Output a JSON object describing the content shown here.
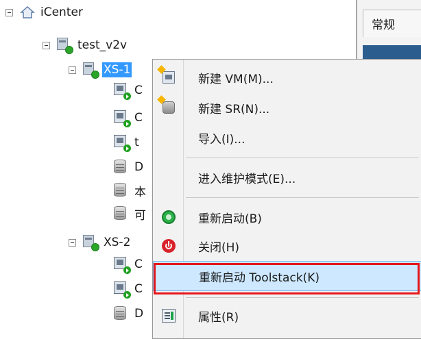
{
  "tree": {
    "root": {
      "label": "iCenter"
    },
    "pool": {
      "label": "test_v2v"
    },
    "host1": {
      "label": "XS-1"
    },
    "host1_children": [
      {
        "label": "C",
        "type": "vm"
      },
      {
        "label": "C",
        "type": "vm"
      },
      {
        "label": "t",
        "type": "vm"
      },
      {
        "label": "D",
        "type": "sr"
      },
      {
        "label": "本",
        "type": "sr"
      },
      {
        "label": "可",
        "type": "sr"
      }
    ],
    "host2": {
      "label": "XS-2"
    },
    "host2_children": [
      {
        "label": "C",
        "type": "vm"
      },
      {
        "label": "C",
        "type": "vm"
      },
      {
        "label": "D",
        "type": "sr"
      }
    ]
  },
  "right_panel": {
    "tab_label": "常规"
  },
  "context_menu": {
    "items": [
      {
        "label": "新建 VM(M)...",
        "icon": "new-vm-icon"
      },
      {
        "label": "新建 SR(N)...",
        "icon": "new-sr-icon"
      },
      {
        "label": "导入(I)...",
        "icon": ""
      },
      {
        "label": "进入维护模式(E)...",
        "icon": ""
      },
      {
        "label": "重新启动(B)",
        "icon": "restart-icon"
      },
      {
        "label": "关闭(H)",
        "icon": "power-icon"
      },
      {
        "label": "重新启动 Toolstack(K)",
        "icon": "",
        "highlighted": true
      },
      {
        "label": "属性(R)",
        "icon": "properties-icon"
      }
    ]
  },
  "colors": {
    "selection": "#3399ff",
    "highlight": "#cde8ff",
    "callout": "#e4161c"
  }
}
